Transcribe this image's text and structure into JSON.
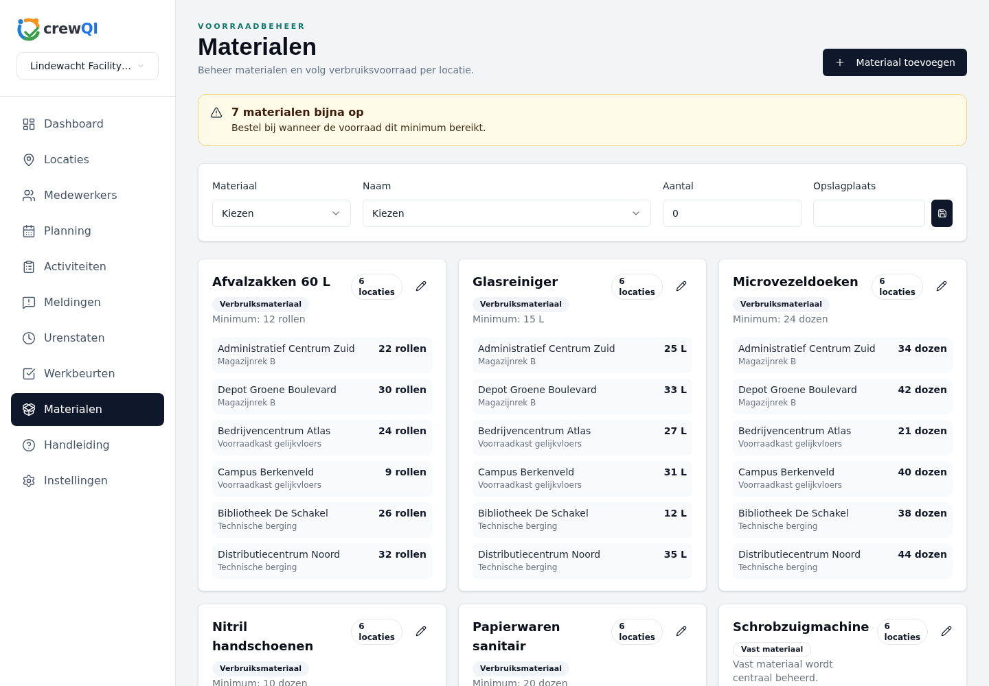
{
  "sidebar": {
    "brand": {
      "word": "crew",
      "accent": "QI"
    },
    "organization_select": {
      "value": "Lindewacht Facility…"
    },
    "nav": [
      {
        "label": "Dashboard",
        "selected": false
      },
      {
        "label": "Locaties",
        "selected": false
      },
      {
        "label": "Medewerkers",
        "selected": false
      },
      {
        "label": "Planning",
        "selected": false
      },
      {
        "label": "Activiteiten",
        "selected": false
      },
      {
        "label": "Meldingen",
        "selected": false
      },
      {
        "label": "Urenstaten",
        "selected": false
      },
      {
        "label": "Werkbeurten",
        "selected": false
      },
      {
        "label": "Materialen",
        "selected": true
      },
      {
        "label": "Handleiding",
        "selected": false
      },
      {
        "label": "Instellingen",
        "selected": false
      }
    ]
  },
  "header": {
    "eyebrow": "VOORRAADBEHEER",
    "title": "Materialen",
    "subtitle": "Beheer materialen en volg verbruiksvoorraad per locatie.",
    "add_button": "Materiaal toevoegen"
  },
  "alert": {
    "title": "7 materialen bijna op",
    "message": "Bestel bij wanneer de voorraad dit minimum bereikt."
  },
  "form": {
    "fields": [
      {
        "kind": "select",
        "label": "Materiaal",
        "value": "Kiezen"
      },
      {
        "kind": "select",
        "label": "Naam",
        "value": "Kiezen"
      },
      {
        "kind": "input",
        "label": "Aantal",
        "value": "0"
      },
      {
        "kind": "input",
        "label": "Opslagplaats"
      }
    ]
  },
  "materials": [
    {
      "name": "Afvalzakken 60 L",
      "locations_badge": "6 locaties",
      "kind": "consumable",
      "tag": "Verbruiksmateriaal",
      "note": "Minimum: 12 rollen",
      "stock": [
        {
          "location": "Administratief Centrum Zuid",
          "storage": "Magazijnrek B",
          "quantity": "22 rollen"
        },
        {
          "location": "Depot Groene Boulevard",
          "storage": "Magazijnrek B",
          "quantity": "30 rollen"
        },
        {
          "location": "Bedrijvencentrum Atlas",
          "storage": "Voorraadkast gelijkvloers",
          "quantity": "24 rollen"
        },
        {
          "location": "Campus Berkenveld",
          "storage": "Voorraadkast gelijkvloers",
          "quantity": "9 rollen"
        },
        {
          "location": "Bibliotheek De Schakel",
          "storage": "Technische berging",
          "quantity": "26 rollen"
        },
        {
          "location": "Distributiecentrum Noord",
          "storage": "Technische berging",
          "quantity": "32 rollen"
        }
      ]
    },
    {
      "name": "Glasreiniger",
      "locations_badge": "6 locaties",
      "kind": "consumable",
      "tag": "Verbruiksmateriaal",
      "note": "Minimum: 15 L",
      "stock": [
        {
          "location": "Administratief Centrum Zuid",
          "storage": "Magazijnrek B",
          "quantity": "25 L"
        },
        {
          "location": "Depot Groene Boulevard",
          "storage": "Magazijnrek B",
          "quantity": "33 L"
        },
        {
          "location": "Bedrijvencentrum Atlas",
          "storage": "Voorraadkast gelijkvloers",
          "quantity": "27 L"
        },
        {
          "location": "Campus Berkenveld",
          "storage": "Voorraadkast gelijkvloers",
          "quantity": "31 L"
        },
        {
          "location": "Bibliotheek De Schakel",
          "storage": "Technische berging",
          "quantity": "12 L"
        },
        {
          "location": "Distributiecentrum Noord",
          "storage": "Technische berging",
          "quantity": "35 L"
        }
      ]
    },
    {
      "name": "Microvezeldoeken",
      "locations_badge": "6 locaties",
      "kind": "consumable",
      "tag": "Verbruiksmateriaal",
      "note": "Minimum: 24 dozen",
      "stock": [
        {
          "location": "Administratief Centrum Zuid",
          "storage": "Magazijnrek B",
          "quantity": "34 dozen"
        },
        {
          "location": "Depot Groene Boulevard",
          "storage": "Magazijnrek B",
          "quantity": "42 dozen"
        },
        {
          "location": "Bedrijvencentrum Atlas",
          "storage": "Voorraadkast gelijkvloers",
          "quantity": "21 dozen"
        },
        {
          "location": "Campus Berkenveld",
          "storage": "Voorraadkast gelijkvloers",
          "quantity": "40 dozen"
        },
        {
          "location": "Bibliotheek De Schakel",
          "storage": "Technische berging",
          "quantity": "38 dozen"
        },
        {
          "location": "Distributiecentrum Noord",
          "storage": "Technische berging",
          "quantity": "44 dozen"
        }
      ]
    },
    {
      "name": "Nitril handschoenen",
      "locations_badge": "6 locaties",
      "kind": "consumable",
      "tag": "Verbruiksmateriaal",
      "note": "Minimum: 10 dozen"
    },
    {
      "name": "Papierwaren sanitair",
      "locations_badge": "6 locaties",
      "kind": "consumable",
      "tag": "Verbruiksmateriaal",
      "note": "Minimum: 20 dozen"
    },
    {
      "name": "Schrobzuigmachine",
      "locations_badge": "6 locaties",
      "kind": "fixed",
      "tag": "Vast materiaal",
      "note": "Vast materiaal wordt centraal beheerd."
    }
  ]
}
